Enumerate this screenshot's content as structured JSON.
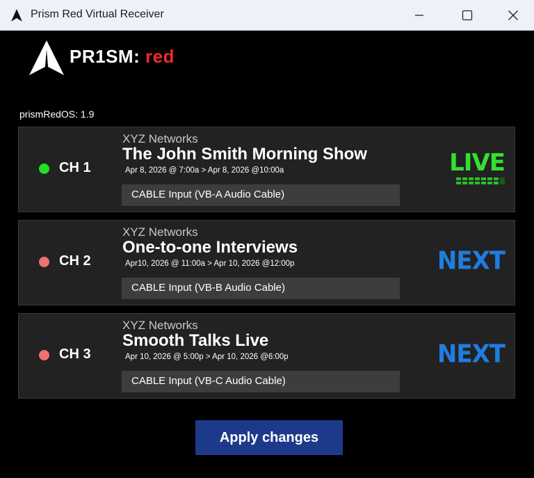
{
  "window": {
    "title": "Prism Red Virtual Receiver",
    "minimize_icon": "minimize-icon",
    "maximize_icon": "maximize-icon",
    "close_icon": "close-icon"
  },
  "brand": {
    "name": "PR1SM:",
    "suffix": "red",
    "accent_color": "#ee2a2a"
  },
  "os_version": "prismRedOS: 1.9",
  "channels": [
    {
      "label": "CH 1",
      "status_color": "#22e022",
      "network": "XYZ Networks",
      "title": "The John Smith Morning Show",
      "schedule": "Apr 8, 2026 @ 7:00a > Apr 8, 2026 @10:00a",
      "input": "CABLE Input (VB-A Audio Cable)",
      "badge": "LIVE",
      "badge_color": "#33e030"
    },
    {
      "label": "CH 2",
      "status_color": "#f07070",
      "network": "XYZ Networks",
      "title": "One-to-one Interviews",
      "schedule": "Apr10, 2026 @ 11:00a > Apr 10, 2026 @12:00p",
      "input": "CABLE Input (VB-B Audio Cable)",
      "badge": "NEXT",
      "badge_color": "#1f7de0"
    },
    {
      "label": "CH 3",
      "status_color": "#f07070",
      "network": "XYZ Networks",
      "title": "Smooth Talks Live",
      "schedule": "Apr 10, 2026 @ 5:00p > Apr 10, 2026 @6:00p",
      "input": "CABLE Input (VB-C Audio Cable)",
      "badge": "NEXT",
      "badge_color": "#1f7de0"
    }
  ],
  "apply_button": "Apply changes"
}
